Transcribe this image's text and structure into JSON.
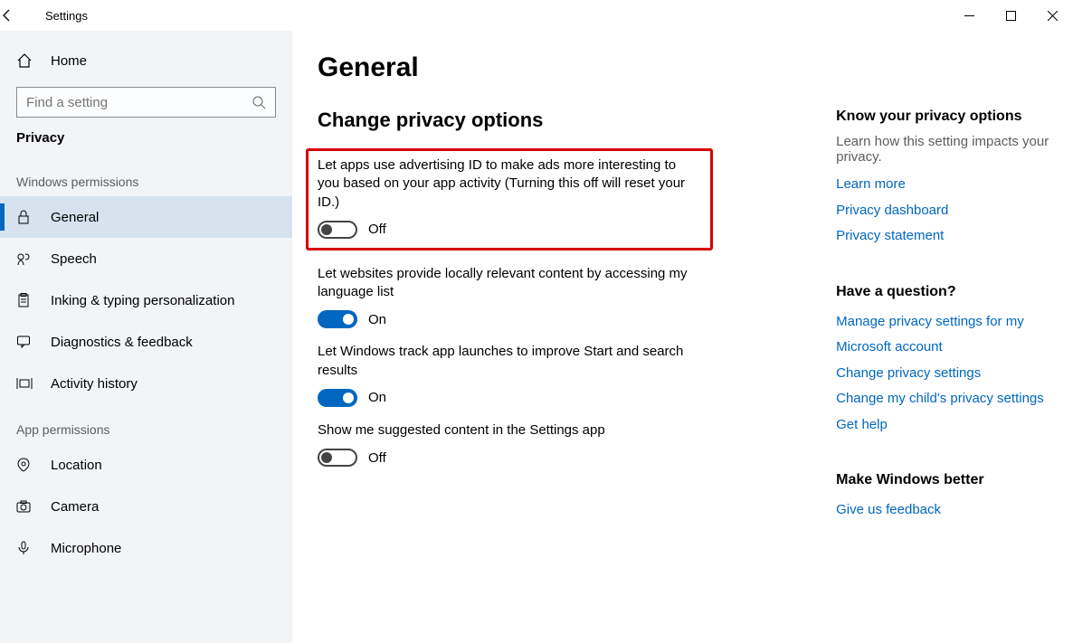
{
  "window": {
    "title": "Settings"
  },
  "sidebar": {
    "home": "Home",
    "search_placeholder": "Find a setting",
    "category": "Privacy",
    "section1": "Windows permissions",
    "section2": "App permissions",
    "items_win": [
      {
        "label": "General"
      },
      {
        "label": "Speech"
      },
      {
        "label": "Inking & typing personalization"
      },
      {
        "label": "Diagnostics & feedback"
      },
      {
        "label": "Activity history"
      }
    ],
    "items_app": [
      {
        "label": "Location"
      },
      {
        "label": "Camera"
      },
      {
        "label": "Microphone"
      }
    ]
  },
  "page": {
    "title": "General",
    "subtitle": "Change privacy options",
    "options": [
      {
        "label": "Let apps use advertising ID to make ads more interesting to you based on your app activity (Turning this off will reset your ID.)",
        "state": "Off",
        "on": false,
        "highlight": true
      },
      {
        "label": "Let websites provide locally relevant content by accessing my language list",
        "state": "On",
        "on": true
      },
      {
        "label": "Let Windows track app launches to improve Start and search results",
        "state": "On",
        "on": true
      },
      {
        "label": "Show me suggested content in the Settings app",
        "state": "Off",
        "on": false
      }
    ]
  },
  "aside": {
    "b1_title": "Know your privacy options",
    "b1_desc": "Learn how this setting impacts your privacy.",
    "b1_links": [
      "Learn more",
      "Privacy dashboard",
      "Privacy statement"
    ],
    "b2_title": "Have a question?",
    "b2_links": [
      "Manage privacy settings for my Microsoft account",
      "Change privacy settings",
      "Change my child's privacy settings",
      "Get help"
    ],
    "b3_title": "Make Windows better",
    "b3_links": [
      "Give us feedback"
    ]
  }
}
